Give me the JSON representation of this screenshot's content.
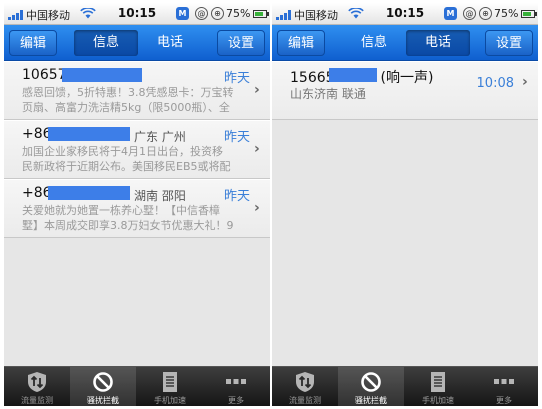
{
  "status_bar": {
    "carrier": "中国移动",
    "time": "10:15",
    "battery": "75%",
    "badge": "M",
    "icon_at": "@",
    "icon_lock": "⊕"
  },
  "nav": {
    "edit": "编辑",
    "settings": "设置",
    "seg_messages": "信息",
    "seg_calls": "电话",
    "active_left": "信息",
    "active_right": "电话"
  },
  "messages": [
    {
      "number": "10657",
      "number_suffix": "",
      "location": "",
      "when": "昨天",
      "preview_line1": "感恩回馈，5折特惠！3.8凭感恩卡：万宝转",
      "preview_line2": "页扇、高富力洗洁精5kg（限5000瓶）、全"
    },
    {
      "number": "+86",
      "location": "广东 广州",
      "when": "昨天",
      "preview_line1": "加国企业家移民将于4月1日出台，投资移",
      "preview_line2": "民新政将于近期公布。美国移民EB5或将配"
    },
    {
      "number": "+86",
      "location": "湖南 邵阳",
      "when": "昨天",
      "preview_line1": "关爱她就为她置一栋养心墅！【中信香樟",
      "preview_line2": "墅】本周成交即享3.8万妇女节优惠大礼！9"
    }
  ],
  "calls": [
    {
      "number": "15665",
      "number_suffix": "(响一声)",
      "location": "山东济南 联通",
      "time": "10:08"
    }
  ],
  "tabbar": [
    {
      "label": "流量监测",
      "icon": "traffic-monitor-icon"
    },
    {
      "label": "骚扰拦截",
      "icon": "block-icon"
    },
    {
      "label": "手机加速",
      "icon": "speedup-icon"
    },
    {
      "label": "更多",
      "icon": "more-icon"
    }
  ],
  "colors": {
    "nav_blue": "#1a6fe0",
    "accent_blue": "#3a7fd8",
    "redaction": "#3d7ee8"
  }
}
